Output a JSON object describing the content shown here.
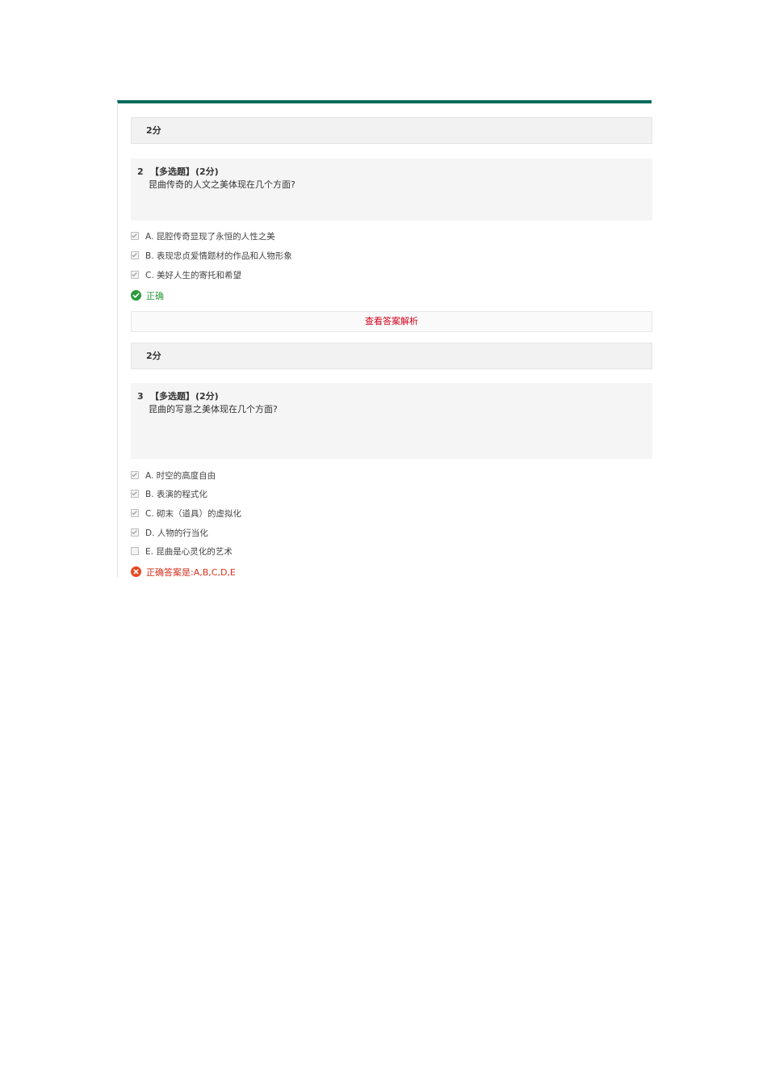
{
  "colors": {
    "accent_green": "#006b5b",
    "correct_green": "#2a9a3a",
    "wrong_red": "#d6311f",
    "link_red": "#d0021b"
  },
  "blocks": [
    {
      "score_label": "2分"
    },
    {
      "question": {
        "number": "2",
        "type": "【多选题】",
        "points": "(2分)",
        "text": "昆曲传奇的人文之美体现在几个方面?"
      },
      "options": [
        {
          "label": "A. 昆腔传奇显现了永恒的人性之美",
          "checked": true
        },
        {
          "label": "B. 表现忠贞爱情题材的作品和人物形象",
          "checked": true
        },
        {
          "label": "C. 美好人生的寄托和希望",
          "checked": true
        }
      ],
      "result": {
        "status": "correct",
        "icon": "check-circle-icon",
        "text": "正确"
      },
      "analysis_link": "查看答案解析"
    },
    {
      "score_label": "2分"
    },
    {
      "question": {
        "number": "3",
        "type": "【多选题】",
        "points": "(2分)",
        "text": "昆曲的写意之美体现在几个方面?"
      },
      "options": [
        {
          "label": "A. 时空的高度自由",
          "checked": true
        },
        {
          "label": "B. 表演的程式化",
          "checked": true
        },
        {
          "label": "C. 砌末（道具）的虚拟化",
          "checked": true
        },
        {
          "label": "D. 人物的行当化",
          "checked": true
        },
        {
          "label": "E. 昆曲是心灵化的艺术",
          "checked": false
        }
      ],
      "result": {
        "status": "wrong",
        "icon": "x-circle-icon",
        "text": "正确答案是:A,B,C,D,E"
      }
    }
  ]
}
